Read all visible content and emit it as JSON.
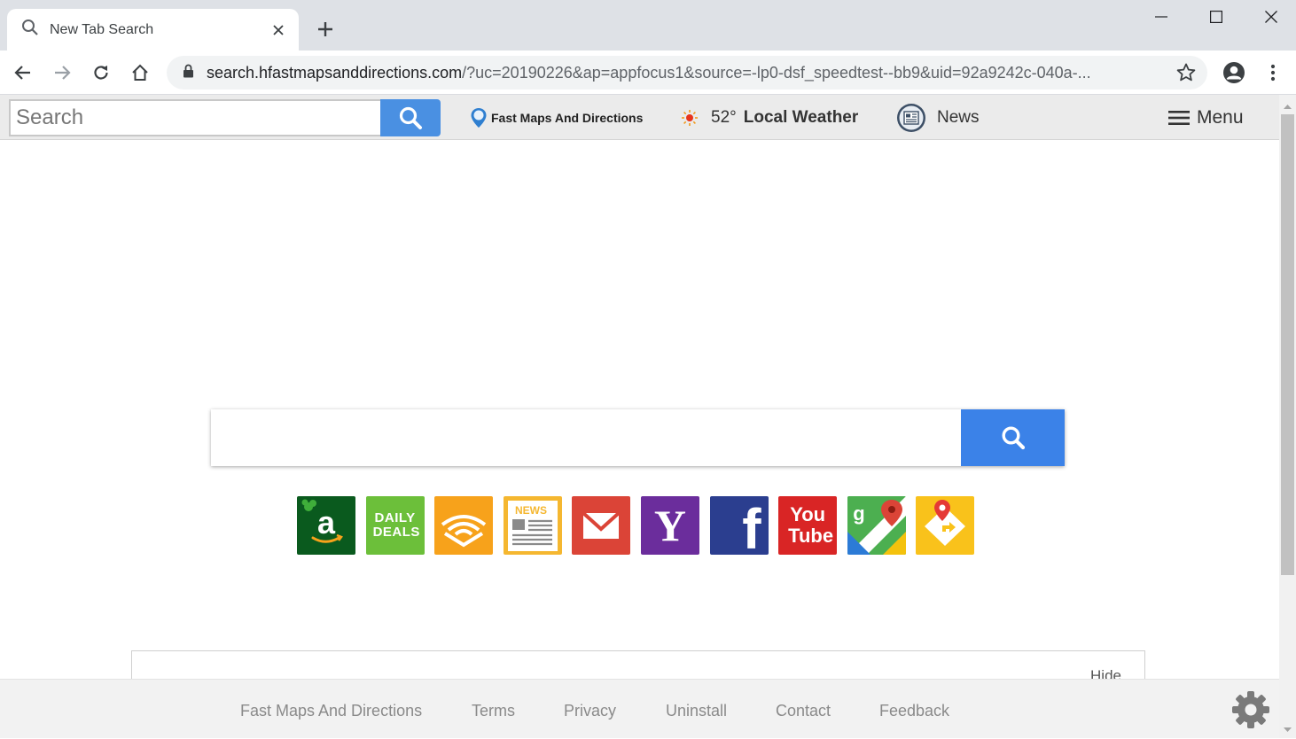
{
  "browser": {
    "tab": {
      "title": "New Tab Search"
    },
    "address": {
      "host": "search.hfastmapsanddirections.com",
      "path": "/?uc=20190226&ap=appfocus1&source=-lp0-dsf_speedtest--bb9&uid=92a9242c-040a-..."
    }
  },
  "header": {
    "search_placeholder": "Search",
    "brand": "Fast Maps And Directions",
    "weather": {
      "temp": "52°",
      "label": "Local Weather"
    },
    "news": "News",
    "menu": "Menu"
  },
  "shortcuts": [
    {
      "name": "amazon",
      "label": "a",
      "color": "#0a5a1e"
    },
    {
      "name": "daily-deals",
      "label": "DAILY DEALS",
      "color": "#6cbf3a"
    },
    {
      "name": "audible",
      "color": "#f7a21b"
    },
    {
      "name": "news",
      "label": "NEWS",
      "color": "#f5b730"
    },
    {
      "name": "gmail",
      "color": "#db4437"
    },
    {
      "name": "yahoo",
      "label": "Y",
      "color": "#6b2d9c"
    },
    {
      "name": "facebook",
      "label": "f",
      "color": "#2b3e8f"
    },
    {
      "name": "youtube",
      "label": "You Tube",
      "color": "#d92525"
    },
    {
      "name": "google-maps",
      "color": "#4caf50"
    },
    {
      "name": "maps-directions",
      "color": "#f9c21b"
    }
  ],
  "card": {
    "hide": "Hide"
  },
  "footer": {
    "links": [
      "Fast Maps And Directions",
      "Terms",
      "Privacy",
      "Uninstall",
      "Contact",
      "Feedback"
    ]
  },
  "colors": {
    "accent": "#3b82e8",
    "header_bg": "#ebebeb",
    "footer_bg": "#f2f2f2"
  }
}
